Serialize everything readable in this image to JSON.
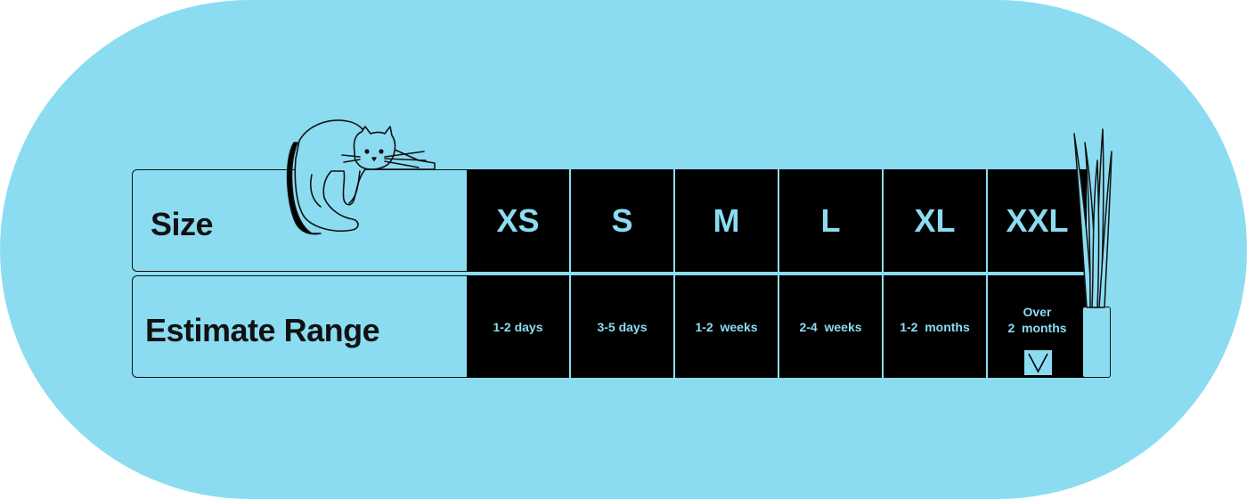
{
  "row_labels": {
    "size": "Size",
    "estimate": "Estimate Range"
  },
  "sizes": [
    {
      "size": "XS",
      "estimate": "1-2 days"
    },
    {
      "size": "S",
      "estimate": "3-5 days"
    },
    {
      "size": "M",
      "estimate": "1-2  weeks"
    },
    {
      "size": "L",
      "estimate": "2-4  weeks"
    },
    {
      "size": "XL",
      "estimate": "1-2  months"
    },
    {
      "size": "XXL",
      "estimate_line1": "Over",
      "estimate_line2": "2  months"
    }
  ],
  "colors": {
    "background": "#8bdcf1",
    "cell": "#000000",
    "text_on_cell": "#8bdcf1",
    "outline": "#111111"
  },
  "decorations": {
    "cat": "cat-illustration",
    "plant": "plant-in-vase-illustration",
    "chevron": "chevron-down-icon"
  }
}
